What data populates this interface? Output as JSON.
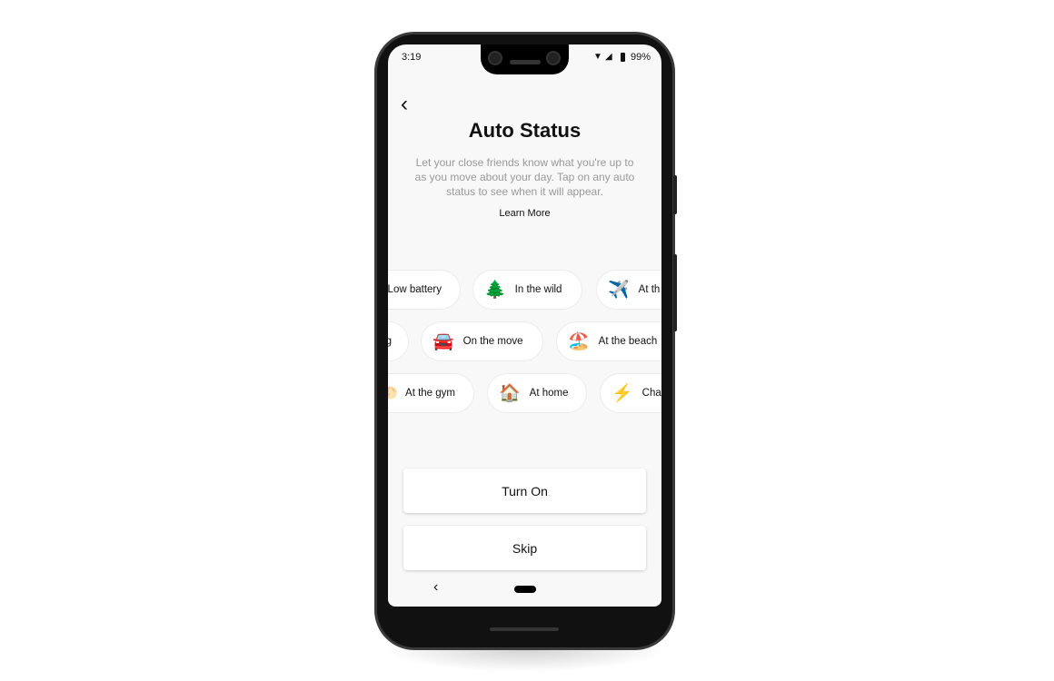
{
  "status_bar": {
    "time": "3:19",
    "battery": "99%",
    "icons": [
      "wifi-icon",
      "signal-icon",
      "battery-icon"
    ]
  },
  "header": {
    "back_icon": "chevron-left-icon",
    "title": "Auto Status",
    "description": "Let your close friends know what you're up to as you move about your day. Tap on any auto status to see when it will appear.",
    "learn_more": "Learn More"
  },
  "chips": [
    {
      "emoji": "",
      "label": "Low battery"
    },
    {
      "emoji": "🌲",
      "label": "In the wild"
    },
    {
      "emoji": "✈️",
      "label": "At th"
    },
    {
      "emoji": "",
      "label": "g"
    },
    {
      "emoji": "🚘",
      "label": "On the move"
    },
    {
      "emoji": "🏖️",
      "label": "At the beach"
    },
    {
      "emoji": "🌕",
      "label": "At the gym"
    },
    {
      "emoji": "🏠",
      "label": "At home"
    },
    {
      "emoji": "⚡",
      "label": "Cha"
    }
  ],
  "actions": {
    "turn_on": "Turn On",
    "skip": "Skip"
  }
}
